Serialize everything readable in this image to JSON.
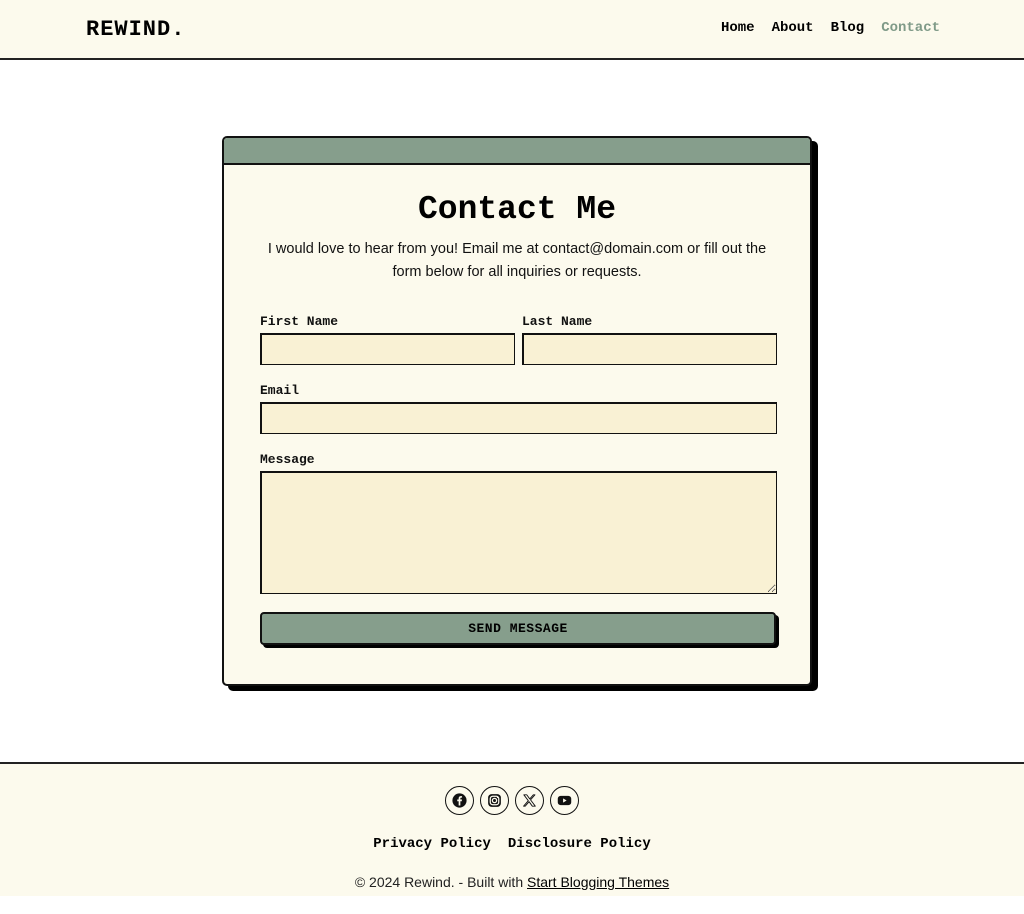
{
  "header": {
    "logo": "REWIND.",
    "nav": [
      {
        "label": "Home"
      },
      {
        "label": "About"
      },
      {
        "label": "Blog"
      },
      {
        "label": "Contact",
        "active": true
      }
    ]
  },
  "contact": {
    "title": "Contact Me",
    "intro": "I would love to hear from you! Email me at contact@domain.com or fill out the form below for all inquiries or requests.",
    "fields": {
      "first_name_label": "First Name",
      "first_name_value": "",
      "last_name_label": "Last Name",
      "last_name_value": "",
      "email_label": "Email",
      "email_value": "",
      "message_label": "Message",
      "message_value": ""
    },
    "send_label": "SEND MESSAGE"
  },
  "footer": {
    "social": [
      {
        "icon": "facebook-icon"
      },
      {
        "icon": "instagram-icon"
      },
      {
        "icon": "x-icon"
      },
      {
        "icon": "youtube-icon"
      }
    ],
    "links": [
      {
        "label": "Privacy Policy"
      },
      {
        "label": "Disclosure Policy"
      }
    ],
    "copyright_prefix": "© 2024 Rewind. - Built with ",
    "copyright_link": "Start Blogging Themes"
  },
  "colors": {
    "accent": "#869e8c",
    "nav_active": "#7f9a88",
    "cream": "#fcfaed",
    "input_bg": "#f9f1d4"
  }
}
